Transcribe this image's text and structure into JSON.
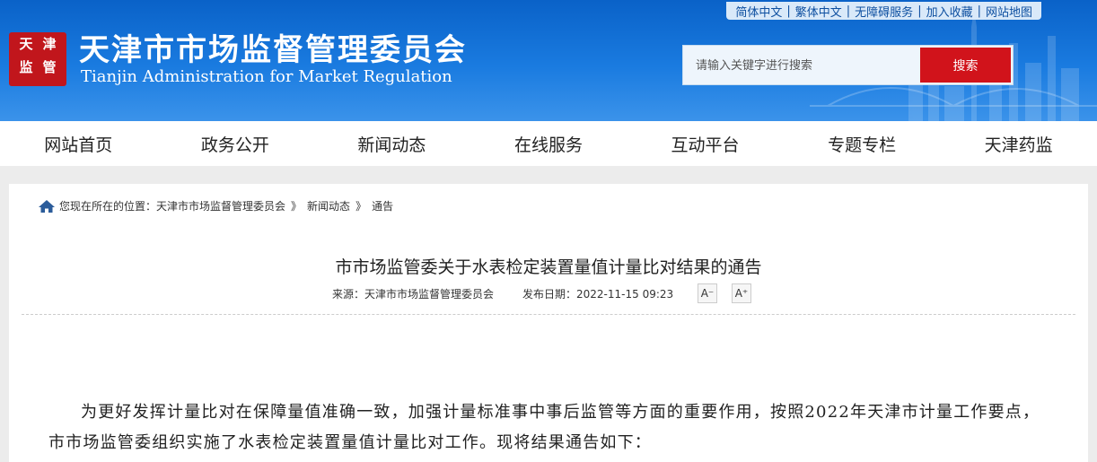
{
  "header": {
    "top_links": [
      "简体中文",
      "繁体中文",
      "无障碍服务",
      "加入收藏",
      "网站地图"
    ],
    "logo_chars": [
      "天",
      "津",
      "监",
      "管"
    ],
    "title": "天津市市场监督管理委员会",
    "subtitle": "Tianjin Administration for Market Regulation",
    "search": {
      "placeholder": "请输入关键字进行搜索",
      "button": "搜索"
    }
  },
  "nav": [
    "网站首页",
    "政务公开",
    "新闻动态",
    "在线服务",
    "互动平台",
    "专题专栏",
    "天津药监"
  ],
  "breadcrumb": {
    "prefix": "您现在所在的位置：",
    "items": [
      "天津市市场监督管理委员会",
      "新闻动态",
      "通告"
    ],
    "separator": "》"
  },
  "article": {
    "title": "市市场监管委关于水表检定装置量值计量比对结果的通告",
    "source": "来源：天津市市场监督管理委员会",
    "date": "发布日期：2022-11-15 09:23",
    "font_decrease": "A⁻",
    "font_increase": "A⁺",
    "paragraph": "为更好发挥计量比对在保障量值准确一致，加强计量标准事中事后监管等方面的重要作用，按照2022年天津市计量工作要点，市市场监管委组织实施了水表检定装置量值计量比对工作。现将结果通告如下："
  },
  "colors": {
    "header_blue": "#0a62c8",
    "search_red": "#d1131b",
    "seal_red": "#c1161c"
  }
}
